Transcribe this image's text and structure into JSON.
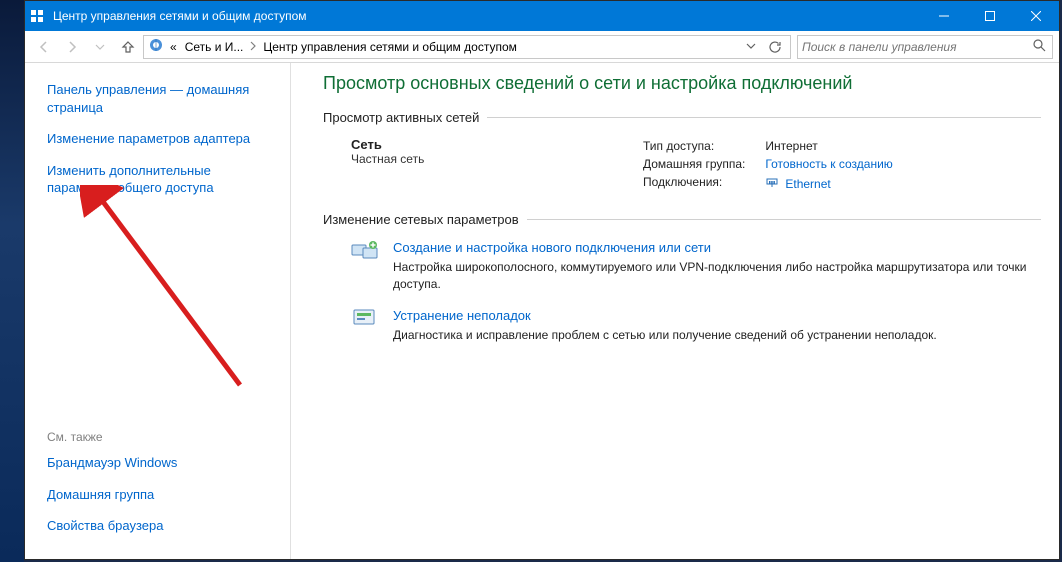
{
  "window": {
    "title": "Центр управления сетями и общим доступом"
  },
  "addressbar": {
    "crumb1_prefix": "«",
    "crumb1": "Сеть и И...",
    "crumb2": "Центр управления сетями и общим доступом"
  },
  "search": {
    "placeholder": "Поиск в панели управления"
  },
  "sidebar": {
    "home": "Панель управления — домашняя страница",
    "link1": "Изменение параметров адаптера",
    "link2": "Изменить дополнительные параметры общего доступа",
    "see_also_header": "См. также",
    "see_also": {
      "a": "Брандмауэр Windows",
      "b": "Домашняя группа",
      "c": "Свойства браузера"
    }
  },
  "main": {
    "page_title": "Просмотр основных сведений о сети и настройка подключений",
    "active_nets_label": "Просмотр активных сетей",
    "network": {
      "name": "Сеть",
      "category": "Частная сеть",
      "access_type_label": "Тип доступа:",
      "access_type_value": "Интернет",
      "homegroup_label": "Домашняя группа:",
      "homegroup_value": "Готовность к созданию",
      "connections_label": "Подключения:",
      "connections_value": "Ethernet"
    },
    "change_settings_label": "Изменение сетевых параметров",
    "task1": {
      "title": "Создание и настройка нового подключения или сети",
      "desc": "Настройка широкополосного, коммутируемого или VPN-подключения либо настройка маршрутизатора или точки доступа."
    },
    "task2": {
      "title": "Устранение неполадок",
      "desc": "Диагностика и исправление проблем с сетью или получение сведений об устранении неполадок."
    }
  }
}
